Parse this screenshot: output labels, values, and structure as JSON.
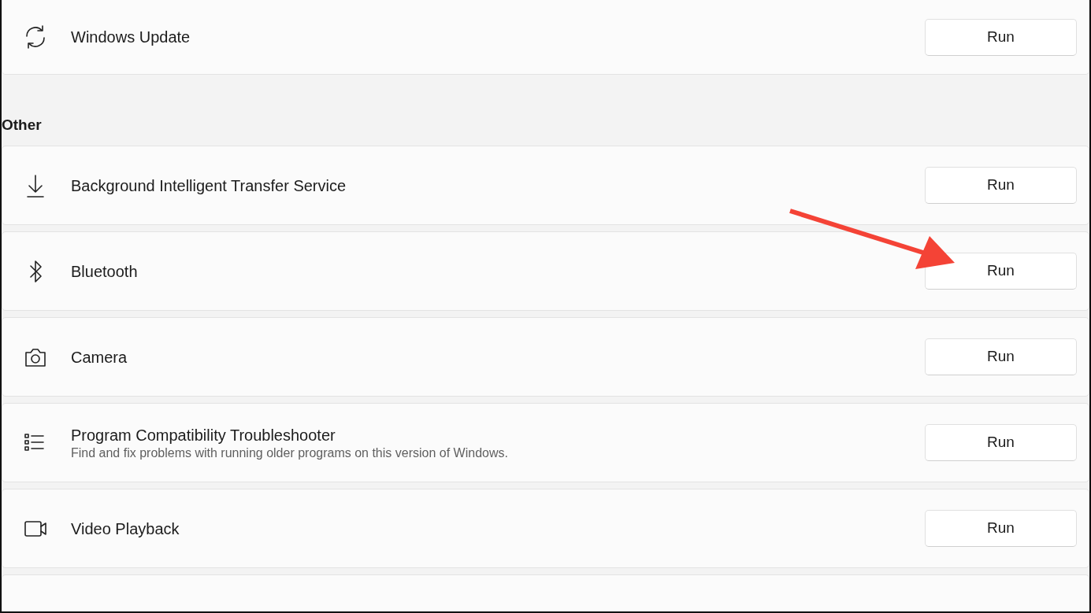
{
  "groups": [
    {
      "items": [
        {
          "title": "Windows Update",
          "button": "Run"
        }
      ]
    },
    {
      "heading": "Other",
      "items": [
        {
          "title": "Background Intelligent Transfer Service",
          "button": "Run"
        },
        {
          "title": "Bluetooth",
          "button": "Run"
        },
        {
          "title": "Camera",
          "button": "Run"
        },
        {
          "title": "Program Compatibility Troubleshooter",
          "description": "Find and fix problems with running older programs on this version of Windows.",
          "button": "Run"
        },
        {
          "title": "Video Playback",
          "button": "Run"
        }
      ]
    }
  ]
}
